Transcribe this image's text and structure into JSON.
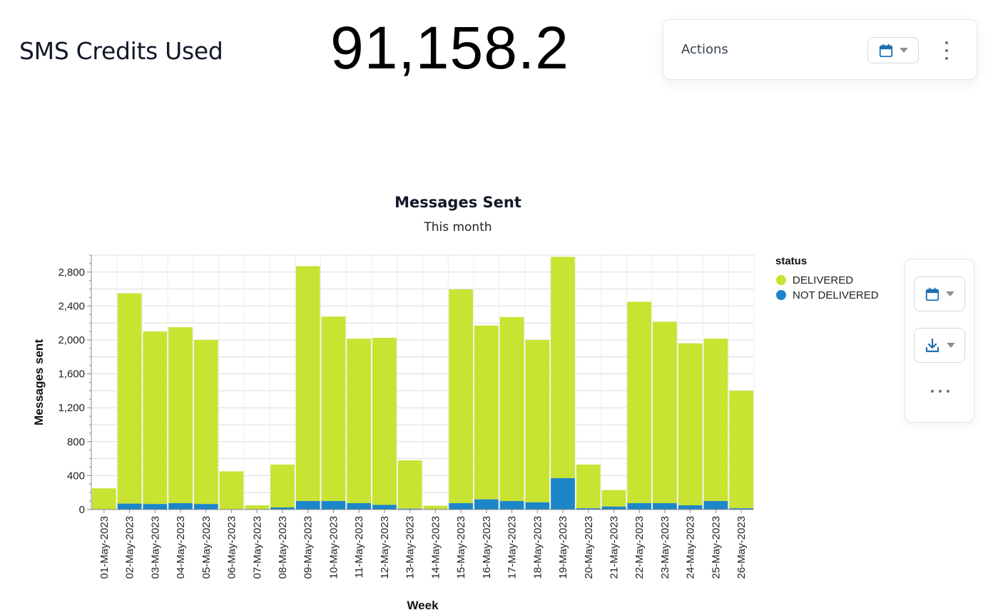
{
  "kpi": {
    "label": "SMS Credits Used",
    "value": "91,158.2"
  },
  "actions": {
    "title": "Actions",
    "date_icon": "calendar-icon",
    "menu_icon": "more-vertical-icon"
  },
  "side_panel": {
    "date_icon": "calendar-icon",
    "download_icon": "download-icon",
    "more_icon": "more-horizontal-icon"
  },
  "colors": {
    "delivered": "#c8e332",
    "not_delivered": "#1c86c8",
    "accent": "#1f6fb2"
  },
  "chart_data": {
    "type": "bar",
    "stacked": true,
    "title": "Messages Sent",
    "subtitle": "This month",
    "xlabel": "Week",
    "ylabel": "Messages sent",
    "ylim": [
      0,
      3000
    ],
    "yticks": [
      0,
      400,
      800,
      1200,
      1600,
      2000,
      2400,
      2800
    ],
    "ytick_labels": [
      "0",
      "400",
      "800",
      "1,200",
      "1,600",
      "2,000",
      "2,400",
      "2,800"
    ],
    "grid": true,
    "legend": {
      "title": "status",
      "placement": "right"
    },
    "categories": [
      "01-May-2023",
      "02-May-2023",
      "03-May-2023",
      "04-May-2023",
      "05-May-2023",
      "06-May-2023",
      "07-May-2023",
      "08-May-2023",
      "09-May-2023",
      "10-May-2023",
      "11-May-2023",
      "12-May-2023",
      "13-May-2023",
      "14-May-2023",
      "15-May-2023",
      "16-May-2023",
      "17-May-2023",
      "18-May-2023",
      "19-May-2023",
      "20-May-2023",
      "21-May-2023",
      "22-May-2023",
      "23-May-2023",
      "24-May-2023",
      "25-May-2023",
      "26-May-2023"
    ],
    "series": [
      {
        "name": "NOT DELIVERED",
        "color": "#1c86c8",
        "values": [
          5,
          70,
          65,
          75,
          65,
          5,
          5,
          25,
          100,
          100,
          75,
          55,
          10,
          5,
          75,
          120,
          100,
          85,
          370,
          15,
          35,
          75,
          75,
          50,
          100,
          15
        ]
      },
      {
        "name": "DELIVERED",
        "color": "#c8e332",
        "values": [
          245,
          2480,
          2035,
          2075,
          1935,
          445,
          45,
          505,
          2770,
          2175,
          1940,
          1970,
          570,
          40,
          2520,
          2050,
          2170,
          1915,
          2610,
          515,
          195,
          2375,
          2140,
          1910,
          1915,
          1385
        ]
      }
    ]
  }
}
